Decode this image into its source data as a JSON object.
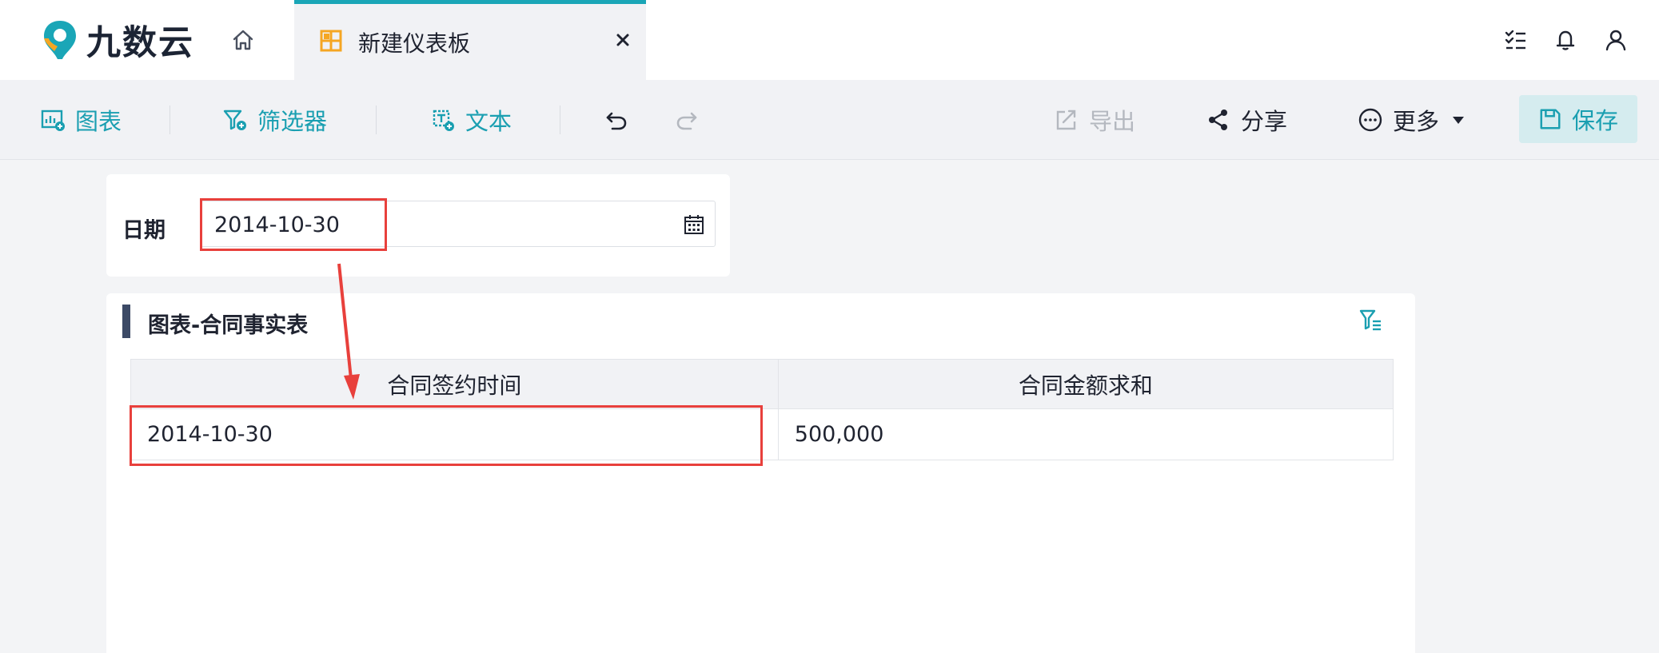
{
  "app": {
    "logo_text": "九数云"
  },
  "tab": {
    "label": "新建仪表板"
  },
  "toolbar": {
    "chart_label": "图表",
    "filter_label": "筛选器",
    "text_label": "文本",
    "export_label": "导出",
    "share_label": "分享",
    "more_label": "更多",
    "save_label": "保存"
  },
  "filter": {
    "label": "日期",
    "value": "2014-10-30"
  },
  "chart": {
    "title": "图表-合同事实表",
    "columns": [
      "合同签约时间",
      "合同金额求和"
    ],
    "rows": [
      [
        "2014-10-30",
        "500,000"
      ]
    ]
  },
  "colors": {
    "accent": "#1aa6b7",
    "highlight": "#e8403c",
    "tab_icon": "#f5a623"
  }
}
